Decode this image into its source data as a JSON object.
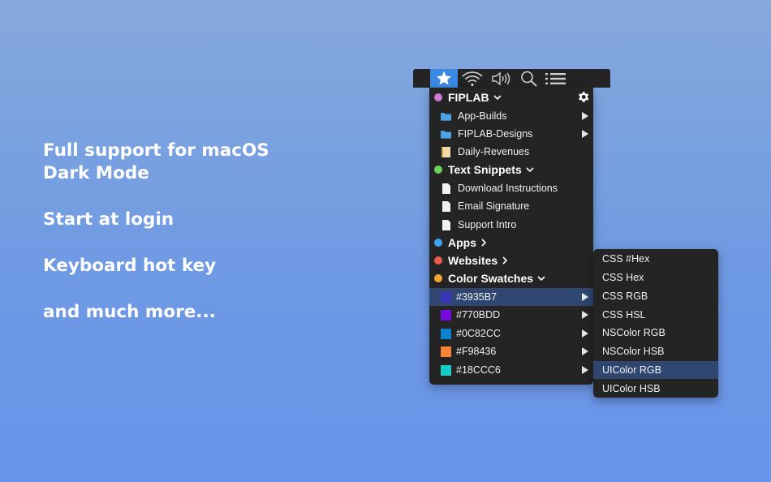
{
  "features": [
    "Full support for macOS",
    "Dark Mode",
    "Start at login",
    "Keyboard hot key",
    "and much more..."
  ],
  "menubar": {
    "icons": [
      "star-icon",
      "wifi-icon",
      "volume-icon",
      "search-icon",
      "list-icon"
    ],
    "accent": "#3b88e4"
  },
  "menu": {
    "groups": {
      "fiplab": {
        "label": "FIPLAB",
        "color": "#d07ad6"
      },
      "snippets": {
        "label": "Text Snippets",
        "color": "#6cd35a"
      },
      "apps": {
        "label": "Apps",
        "color": "#3aa7f0"
      },
      "websites": {
        "label": "Websites",
        "color": "#ee5a4c"
      },
      "swatches": {
        "label": "Color Swatches",
        "color": "#f5a533"
      }
    },
    "fiplab_items": [
      "App-Builds",
      "FIPLAB-Designs",
      "Daily-Revenues"
    ],
    "snippet_items": [
      "Download Instructions",
      "Email Signature",
      "Support Intro"
    ],
    "swatch_items": [
      {
        "label": "#3935B7",
        "color": "#3935B7"
      },
      {
        "label": "#770BDD",
        "color": "#770BDD"
      },
      {
        "label": "#0C82CC",
        "color": "#0C82CC"
      },
      {
        "label": "#F98436",
        "color": "#F98436"
      },
      {
        "label": "#18CCC6",
        "color": "#18CCC6"
      }
    ],
    "selected_swatch": "#3935B7"
  },
  "submenu": {
    "items": [
      "CSS #Hex",
      "CSS Hex",
      "CSS RGB",
      "CSS HSL",
      "NSColor RGB",
      "NSColor HSB",
      "UIColor RGB",
      "UIColor HSB"
    ],
    "selected": "UIColor RGB"
  }
}
